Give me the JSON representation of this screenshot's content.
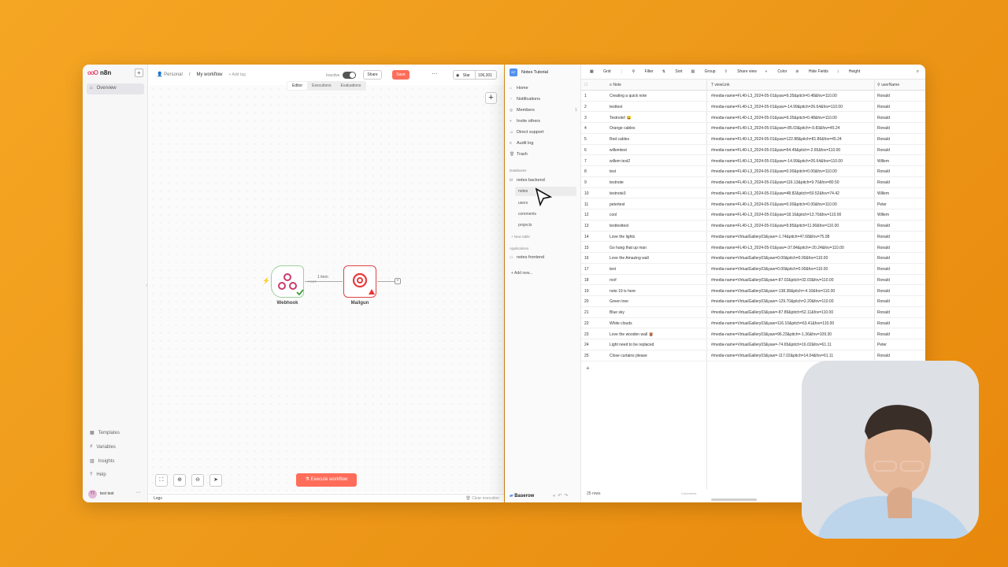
{
  "n8n": {
    "logo": "n8n",
    "nav_overview": "Overview",
    "sidebar_bottom": [
      "Templates",
      "Variables",
      "Insights",
      "Help"
    ],
    "user": "test test",
    "breadcrumb": {
      "project": "Personal",
      "workflow": "My workflow",
      "add_tag": "+ Add tag"
    },
    "status": "Inactive",
    "share": "Share",
    "save": "Save",
    "github": {
      "star": "Star",
      "count": "106,301"
    },
    "tabs": [
      "Editor",
      "Executions",
      "Evaluations"
    ],
    "nodes": [
      {
        "name": "Webhook"
      },
      {
        "name": "Mailgun"
      }
    ],
    "connection_label": "1 item",
    "connection_method": "POST",
    "execute": "Execute workflow",
    "logs": "Logs",
    "clear_execution": "Clear execution"
  },
  "baserow": {
    "workspace": "Notes Tutorial",
    "menu": [
      "Home",
      "Notifications",
      "Members",
      "Invite others",
      "Direct support",
      "Audit log",
      "Trash"
    ],
    "members_count": "1",
    "section_databases": "Databases",
    "database": "notes backend",
    "tables": [
      "notes",
      "users",
      "comments",
      "projects"
    ],
    "new_table": "+ New table",
    "section_applications": "Applications",
    "application": "notes frontend",
    "add_new": "+ Add new...",
    "brand": "Baserow",
    "toolbar": [
      "Grid",
      "Filter",
      "Sort",
      "Group",
      "Share view",
      "Color",
      "Hide Fields",
      "Height"
    ],
    "columns": [
      "Note",
      "viewLink",
      "userName"
    ],
    "rows": [
      [
        "1",
        "Creating a quick note",
        "#media-name=FL40-L3_2024-05-01&yaw=9.35&pitch=0.48&fov=110.00",
        "Ronald"
      ],
      [
        "2",
        "testtest",
        "#media-name=FL40-L3_2024-05-01&yaw=-14.99&pitch=26.64&fov=110.00",
        "Ronald"
      ],
      [
        "3",
        "Testnote! 😀",
        "#media-name=FL40-L3_2024-05-01&yaw=9.35&pitch=0.48&fov=110.00",
        "Ronald"
      ],
      [
        "4",
        "Orange cables",
        "#media-name=FL40-L3_2024-05-01&yaw=-85.03&pitch=-9.83&fov=45.24",
        "Ronald"
      ],
      [
        "5",
        "Red cables",
        "#media-name=FL40-L3_2024-05-01&yaw=122.88&pitch=81.86&fov=45.24",
        "Ronald"
      ],
      [
        "6",
        "willemtest",
        "#media-name=FL40-L3_2024-05-01&yaw=54.49&pitch=-2.65&fov=110.00",
        "Ronald"
      ],
      [
        "7",
        "willem test2",
        "#media-name=FL40-L3_2024-05-01&yaw=-14.99&pitch=26.64&fov=110.00",
        "Willem"
      ],
      [
        "8",
        "test",
        "#media-name=FL40-L3_2024-05-01&yaw=0.00&pitch=0.00&fov=110.00",
        "Ronald"
      ],
      [
        "9",
        "testnote",
        "#media-name=FL40-L3_2024-05-01&yaw=116.13&pitch=9.70&fov=80.50",
        "Ronald"
      ],
      [
        "10",
        "testnote3",
        "#media-name=FL40-L3_2024-05-01&yaw=48.82&pitch=50.52&fov=74.42",
        "Willem"
      ],
      [
        "11",
        "petertest",
        "#media-name=FL40-L3_2024-05-01&yaw=0.00&pitch=0.00&fov=110.00",
        "Peter"
      ],
      [
        "12",
        "cool",
        "#media-name=FL40-L3_2024-05-01&yaw=18.16&pitch=13.70&fov=110.00",
        "Willem"
      ],
      [
        "13",
        "testtesttest",
        "#media-name=FL40-L3_2024-05-01&yaw=9.85&pitch=11.90&fov=110.00",
        "Ronald"
      ],
      [
        "14",
        "Love the lights",
        "#media-name=VirtualGallery03&yaw=-1.74&pitch=47.68&fov=75.08",
        "Ronald"
      ],
      [
        "15",
        "Go hang that up man",
        "#media-name=FL40-L3_2024-05-01&yaw=-37.84&pitch=-20.24&fov=110.00",
        "Ronald"
      ],
      [
        "16",
        "Love the Amazing wall",
        "#media-name=VirtualGallery03&yaw=0.00&pitch=0.00&fov=110.00",
        "Ronald"
      ],
      [
        "17",
        "text",
        "#media-name=VirtualGallery03&yaw=0.00&pitch=0.00&fov=110.00",
        "Ronald"
      ],
      [
        "18",
        "roof",
        "#media-name=VirtualGallery03&yaw=-87.02&pitch=32.03&fov=110.00",
        "Ronald"
      ],
      [
        "19",
        "note 19 is here",
        "#media-name=VirtualGallery03&yaw=-138.38&pitch=-4.10&fov=110.00",
        "Ronald"
      ],
      [
        "20",
        "Green tree",
        "#media-name=VirtualGallery03&yaw=-129.70&pitch=2.20&fov=110.00",
        "Ronald"
      ],
      [
        "21",
        "Blue sky",
        "#media-name=VirtualGallery03&yaw=-87.89&pitch=52.11&fov=110.00",
        "Ronald"
      ],
      [
        "22",
        "White clouds",
        "#media-name=VirtualGallery03&yaw=116.10&pitch=63.41&fov=110.00",
        "Ronald"
      ],
      [
        "23",
        "Love the wooden wall 🪵",
        "#media-name=VirtualGallery03&yaw=96.23&pitch=-1.36&fov=109.30",
        "Ronald"
      ],
      [
        "24",
        "Light need to be replaced",
        "#media-name=VirtualGallery03&yaw=-74.65&pitch=16.02&fov=61.11",
        "Peter"
      ],
      [
        "25",
        "Close curtains please",
        "#media-name=VirtualGallery03&yaw=-117.02&pitch=14.04&fov=61.11",
        "Ronald"
      ]
    ],
    "row_count": "25 rows",
    "comments": "Comments"
  },
  "colors": {
    "n8n_accent": "#ff6d5a",
    "baserow_brand": "#5190ef",
    "background": "#f5a623"
  }
}
